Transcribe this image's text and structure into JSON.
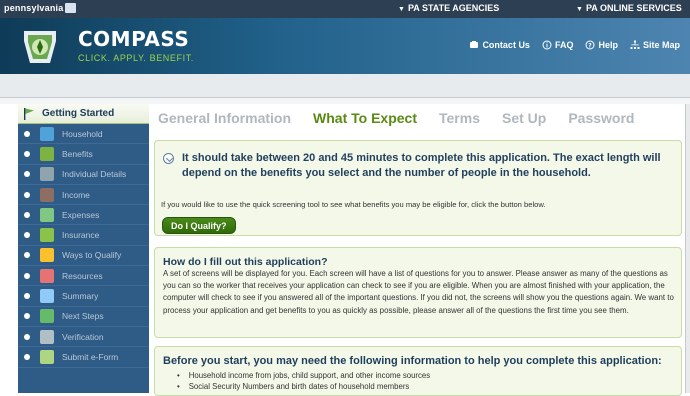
{
  "topbar": {
    "state": "pennsylvania",
    "agencies": "PA STATE AGENCIES",
    "services": "PA ONLINE SERVICES"
  },
  "header": {
    "title": "COMPASS",
    "tagline": "CLICK. APPLY. BENEFIT.",
    "links": [
      {
        "label": "Contact Us",
        "icon": "phone-icon"
      },
      {
        "label": "FAQ",
        "icon": "info-icon"
      },
      {
        "label": "Help",
        "icon": "question-icon"
      },
      {
        "label": "Site Map",
        "icon": "sitemap-icon"
      }
    ],
    "colors": {
      "brand": "#21618a",
      "accent": "#9bd34d"
    }
  },
  "sidebar": {
    "heading": "Getting Started",
    "items": [
      {
        "label": "Household",
        "icon": "house-icon",
        "color": "#4fa3d9"
      },
      {
        "label": "Benefits",
        "icon": "document-icon",
        "color": "#7cb342"
      },
      {
        "label": "Individual Details",
        "icon": "id-card-icon",
        "color": "#90a4ae"
      },
      {
        "label": "Income",
        "icon": "money-icon",
        "color": "#8d6e63"
      },
      {
        "label": "Expenses",
        "icon": "car-icon",
        "color": "#81c784"
      },
      {
        "label": "Insurance",
        "icon": "shield-icon",
        "color": "#8bc34a"
      },
      {
        "label": "Ways to Qualify",
        "icon": "clipboard-icon",
        "color": "#fbc02d"
      },
      {
        "label": "Resources",
        "icon": "car-red-icon",
        "color": "#e57373"
      },
      {
        "label": "Summary",
        "icon": "page-icon",
        "color": "#90caf9"
      },
      {
        "label": "Next Steps",
        "icon": "arrow-icon",
        "color": "#66bb6a"
      },
      {
        "label": "Verification",
        "icon": "check-card-icon",
        "color": "#b0bec5"
      },
      {
        "label": "Submit e-Form",
        "icon": "upload-icon",
        "color": "#aed581"
      }
    ]
  },
  "tabs": [
    {
      "label": "General Information",
      "active": false
    },
    {
      "label": "What To Expect",
      "active": true
    },
    {
      "label": "Terms",
      "active": false
    },
    {
      "label": "Set Up",
      "active": false
    },
    {
      "label": "Password",
      "active": false
    }
  ],
  "expect": {
    "intro": "It should take between 20 and 45 minutes to complete this application. The exact length will depend on the benefits you select and the number of people in the household.",
    "screening_text": "If you would like to use the quick screening tool to see what benefits you may be eligible for, click the button below.",
    "qualify_button": "Do I Qualify?"
  },
  "fill": {
    "heading": "How do I fill out this application?",
    "body": "A set of screens will be displayed for you. Each screen will have a list of questions for you to answer. Please answer as many of the questions as you can so the worker that receives your application can check to see if you are eligible. When you are almost finished with your application, the computer will check to see if you answered all of the important questions. If you did not, the screens will show you the questions again. We want to process your application and get benefits to you as quickly as possible, please answer all of the questions the first time you see them."
  },
  "before": {
    "heading": "Before you start, you may need the following information to help you complete this application:",
    "items": [
      "Household income from jobs, child support, and other income sources",
      "Social Security Numbers and birth dates of household members"
    ]
  }
}
